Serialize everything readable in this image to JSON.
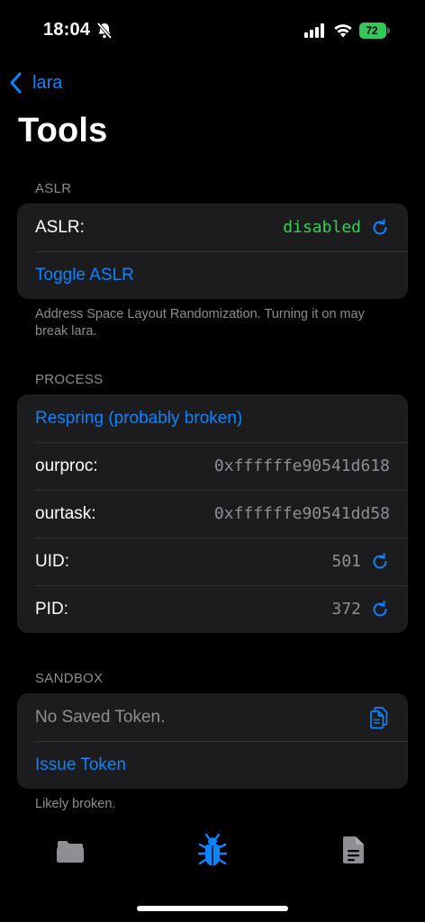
{
  "status_bar": {
    "time": "18:04",
    "battery": "72"
  },
  "nav": {
    "back_label": "lara",
    "title": "Tools"
  },
  "aslr": {
    "header": "ASLR",
    "label": "ASLR:",
    "value": "disabled",
    "toggle_label": "Toggle ASLR",
    "footer": "Address Space Layout Randomization. Turning it on may break lara."
  },
  "process": {
    "header": "PROCESS",
    "respring_label": "Respring (probably broken)",
    "ourproc_label": "ourproc:",
    "ourproc_value": "0xffffffe90541d618",
    "ourtask_label": "ourtask:",
    "ourtask_value": "0xffffffe90541dd58",
    "uid_label": "UID:",
    "uid_value": "501",
    "pid_label": "PID:",
    "pid_value": "372"
  },
  "sandbox": {
    "header": "SANDBOX",
    "token_status": "No Saved Token.",
    "issue_label": "Issue Token",
    "footer": "Likely broken."
  },
  "tabbar": {
    "tabs": [
      {
        "icon": "folder-icon",
        "selected": false
      },
      {
        "icon": "bug-icon",
        "selected": true
      },
      {
        "icon": "document-icon",
        "selected": false
      }
    ]
  },
  "colors": {
    "accent": "#0a84ff",
    "green": "#30d158",
    "background": "#000000",
    "group_background": "#1c1c1e",
    "secondary_text": "#8e8e93"
  }
}
